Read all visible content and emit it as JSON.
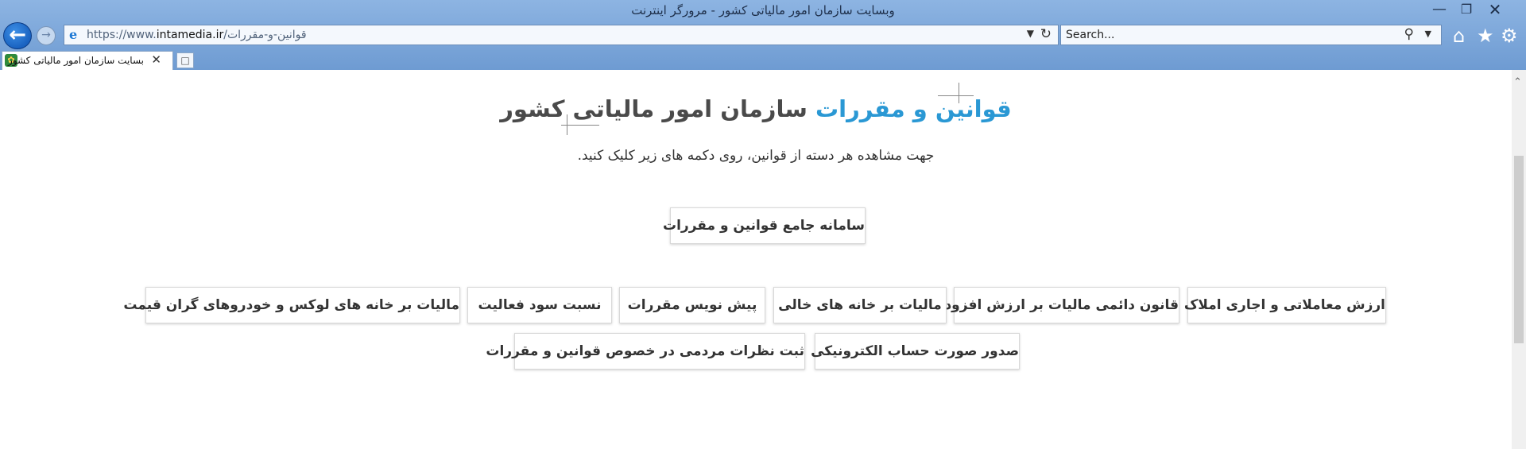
{
  "window": {
    "title": "وبسایت سازمان امور مالیاتی کشور - مرورگر اینترنت"
  },
  "toolbar": {
    "url_scheme": "https://www.",
    "url_domain": "intamedia.ir",
    "url_path": "/قوانین-و-مقررات",
    "search_placeholder": "Search..."
  },
  "tab": {
    "title": "بسایت سازمان امور مالیاتی کشور"
  },
  "page": {
    "heading_accent": "قوانین و مقررات",
    "heading_rest": "سازمان امور مالیاتی کشور",
    "subtitle": "جهت مشاهده هر دسته از قوانین، روی دکمه های زیر کلیک کنید.",
    "main_button": "سامانه جامع قوانین و مقررات",
    "buttons_row1": [
      "ارزش معاملاتی و اجاری املاک",
      "قانون دائمی مالیات بر ارزش افزوده",
      "مالیات بر خانه های خالی",
      "پیش نویس مقررات",
      "نسبت سود فعالیت",
      "مالیات بر خانه های لوکس و خودروهای گران قیمت"
    ],
    "buttons_row2": [
      "صدور صورت حساب الکترونیکی",
      "ثبت نظرات مردمی در خصوص قوانین و مقررات"
    ]
  },
  "colors": {
    "accent": "#2a98d4",
    "heading_dark": "#4a4a4a",
    "chrome": "#7fa8d8"
  }
}
